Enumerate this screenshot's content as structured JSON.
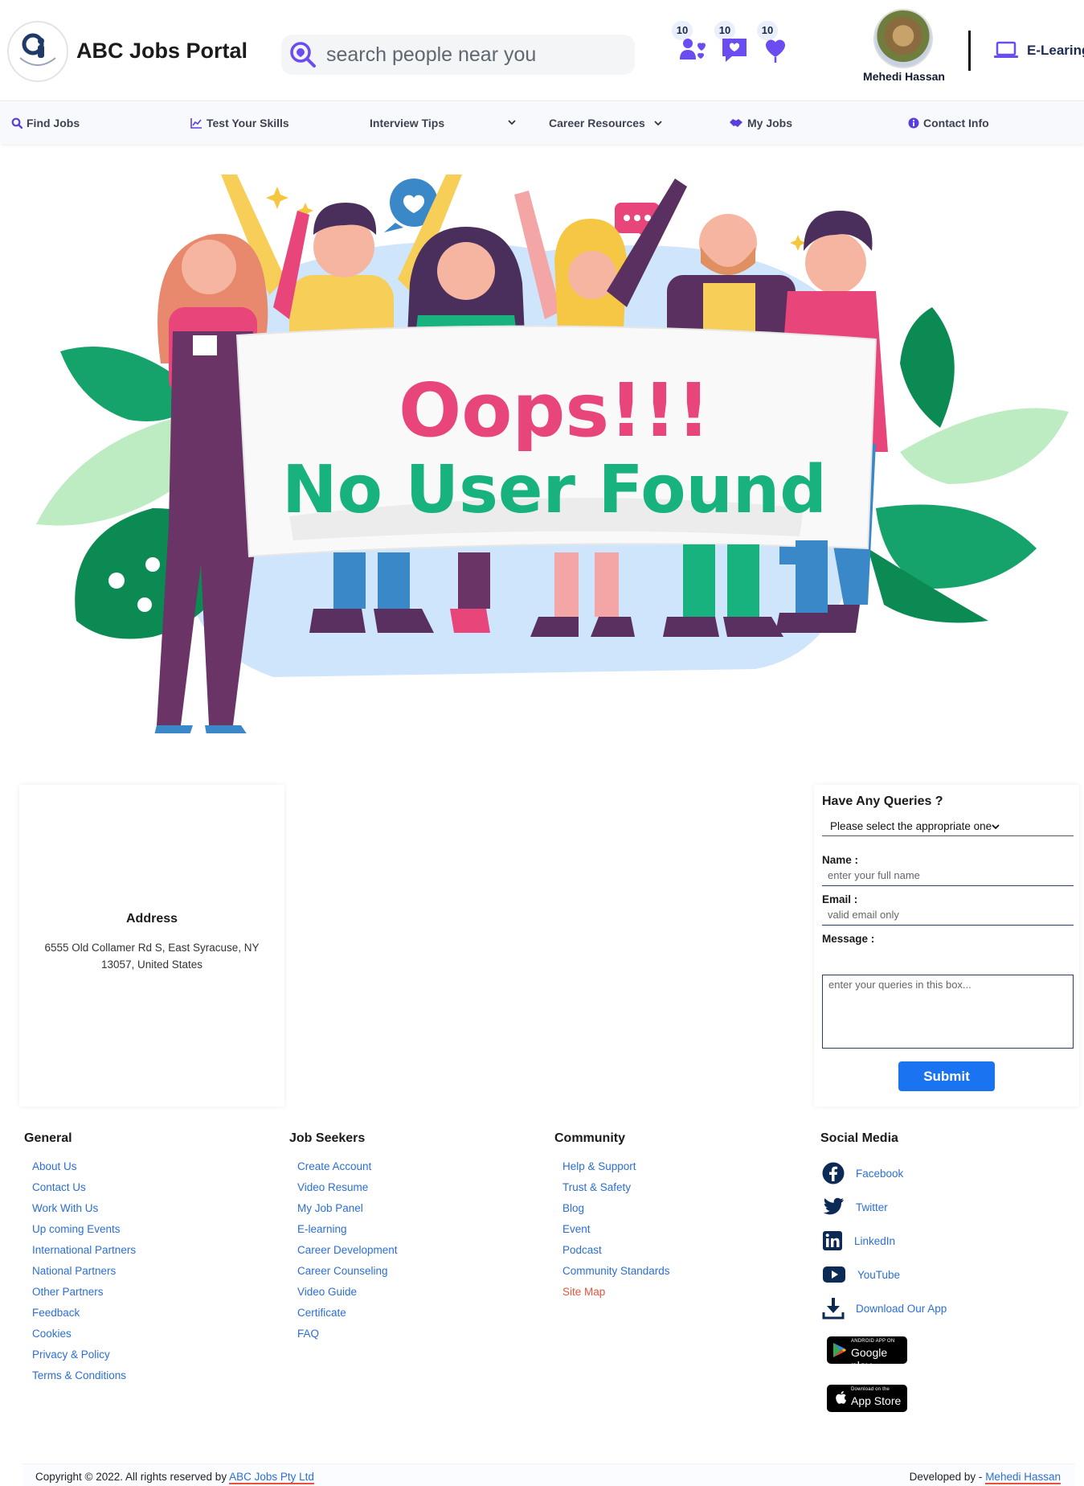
{
  "header": {
    "brand": "ABC Jobs Portal",
    "logo_text": "ABC Jobs Portal",
    "search_placeholder": "search people near you",
    "notifications": [
      {
        "icon": "friend-requests-icon",
        "count": "10"
      },
      {
        "icon": "messages-icon",
        "count": "10"
      },
      {
        "icon": "likes-icon",
        "count": "10"
      }
    ],
    "user_name": "Mehedi Hassan",
    "elearning_label": "E-Learing"
  },
  "nav": {
    "items": [
      {
        "label": "Find Jobs",
        "icon": "search-icon"
      },
      {
        "label": "Test Your Skills",
        "icon": "chart-icon"
      },
      {
        "label": "Interview Tips",
        "icon": "chevron-down-icon"
      },
      {
        "label": "Career Resources",
        "icon": "chevron-down-icon"
      },
      {
        "label": "My Jobs",
        "icon": "handshake-icon"
      },
      {
        "label": "Contact Info",
        "icon": "info-icon"
      }
    ]
  },
  "hero": {
    "line1": "Oops!!!",
    "line2": "No User Found",
    "colors": {
      "line1": "#e8457a",
      "line2": "#17b27d"
    }
  },
  "address": {
    "title": "Address",
    "text": "6555 Old Collamer Rd S, East Syracuse, NY 13057, United States"
  },
  "query_form": {
    "title": "Have Any Queries ?",
    "select_value": "Please select the appropriate one",
    "name_label": "Name :",
    "name_placeholder": "enter your full name",
    "email_label": "Email :",
    "email_placeholder": "valid email only",
    "message_label": "Message :",
    "message_placeholder": "enter your queries in this box...",
    "submit_label": "Submit"
  },
  "footer": {
    "general": {
      "title": "General",
      "links": [
        "About Us",
        "Contact Us",
        "Work With Us",
        "Up coming Events",
        "International Partners",
        "National Partners",
        "Other Partners",
        "Feedback",
        "Cookies",
        "Privacy & Policy",
        "Terms & Conditions"
      ]
    },
    "job_seekers": {
      "title": "Job Seekers",
      "links": [
        "Create Account",
        "Video Resume",
        "My Job Panel",
        "E-learning",
        "Career Development",
        "Career Counseling",
        "Video Guide",
        "Certificate",
        "FAQ"
      ]
    },
    "community": {
      "title": "Community",
      "links": [
        "Help & Support",
        "Trust & Safety",
        "Blog",
        "Event",
        "Podcast",
        "Community Standards",
        "Site Map"
      ]
    },
    "social": {
      "title": "Social Media",
      "links": [
        "Facebook",
        "Twitter",
        "LinkedIn",
        "YouTube",
        "Download Our App"
      ],
      "google_play_small": "ANDROID APP ON",
      "google_play_big": "Google play",
      "app_store_small": "Download on the",
      "app_store_big": "App Store"
    }
  },
  "copyright": {
    "prefix": "Copyright © 2022. All rights reserved by",
    "company": "ABC Jobs Pty Ltd",
    "dev_prefix": "Developed by -",
    "developer": "Mehedi Hassan"
  },
  "colors": {
    "accent_blue": "#1a73f0",
    "link_blue": "#2b6ed6",
    "icon_purple": "#6a4cf0",
    "site_map_red": "#e5533c"
  }
}
